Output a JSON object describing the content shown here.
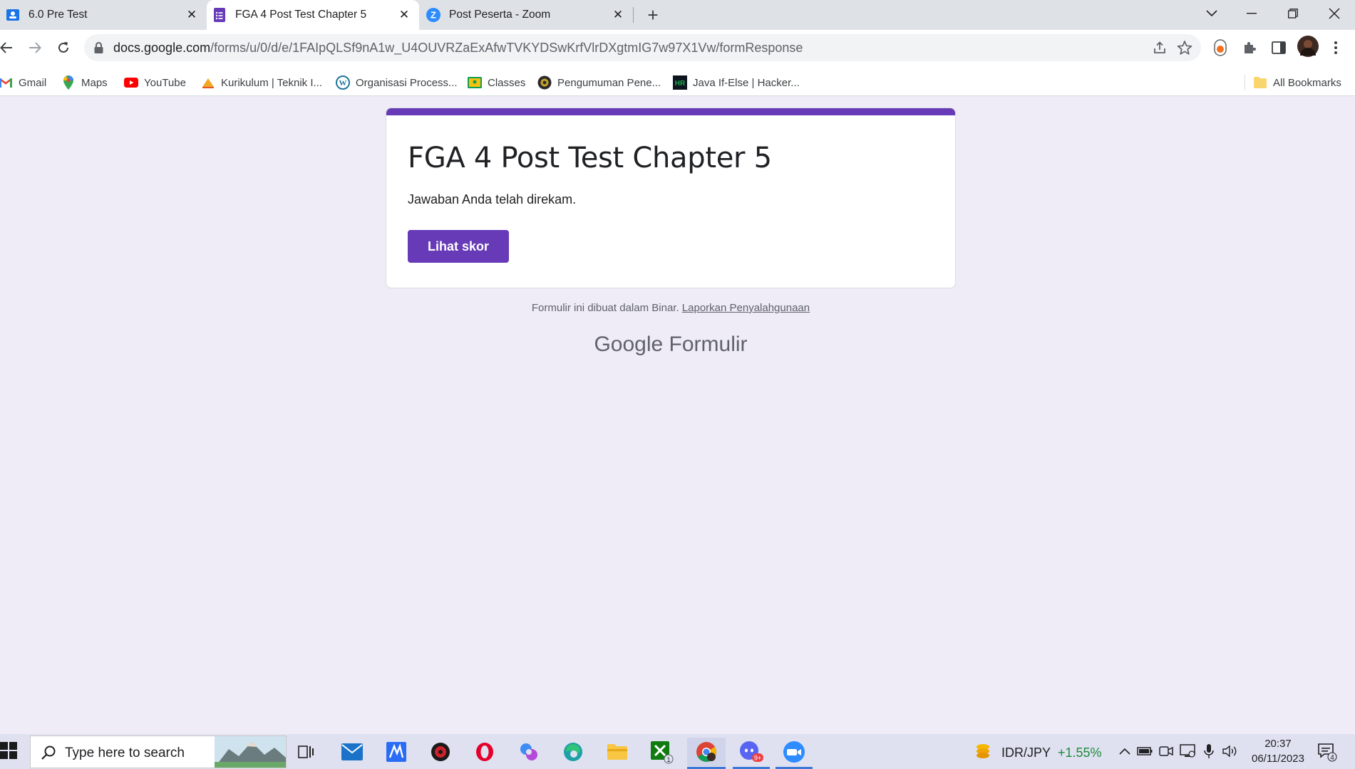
{
  "browser": {
    "tabs": [
      {
        "title": "6.0 Pre Test",
        "active": false,
        "icon": "google-classroom-icon"
      },
      {
        "title": "FGA 4 Post Test Chapter 5",
        "active": true,
        "icon": "google-forms-icon"
      },
      {
        "title": "Post Peserta - Zoom",
        "active": false,
        "icon": "zoom-icon"
      }
    ],
    "url_host": "docs.google.com",
    "url_path": "/forms/u/0/d/e/1FAIpQLSf9nA1w_U4OUVRZaExAfwTVKYDSwKrfVlrDXgtmIG7w97X1Vw/formResponse",
    "bookmarks": [
      {
        "label": "Gmail",
        "icon": "gmail-icon"
      },
      {
        "label": "Maps",
        "icon": "maps-icon"
      },
      {
        "label": "YouTube",
        "icon": "youtube-icon"
      },
      {
        "label": "Kurikulum | Teknik I...",
        "icon": "kurikulum-icon"
      },
      {
        "label": "Organisasi Process...",
        "icon": "wordpress-icon"
      },
      {
        "label": "Classes",
        "icon": "classroom-icon"
      },
      {
        "label": "Pengumuman Pene...",
        "icon": "university-icon"
      },
      {
        "label": "Java If-Else | Hacker...",
        "icon": "hackerrank-icon"
      }
    ],
    "all_bookmarks": "All Bookmarks"
  },
  "form": {
    "title": "FGA 4 Post Test Chapter 5",
    "message": "Jawaban Anda telah direkam.",
    "score_button": "Lihat skor",
    "accent_color": "#673ab7",
    "footer_text": "Formulir ini dibuat dalam Binar.",
    "footer_link": "Laporkan Penyalahgunaan",
    "logo_google": "Google",
    "logo_product": "Formulir"
  },
  "taskbar": {
    "search_placeholder": "Type here to search",
    "ticker_symbol": "IDR/JPY",
    "ticker_change": "+1.55%",
    "time": "20:37",
    "date": "06/11/2023",
    "notification_count": "4",
    "xbox_badge": "1",
    "discord_badge": "9+"
  }
}
